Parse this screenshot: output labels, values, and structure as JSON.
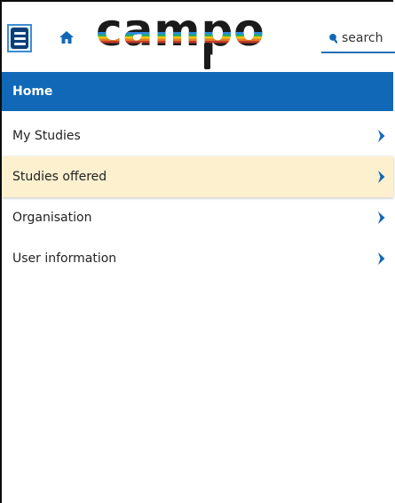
{
  "header": {
    "logo_text": "campo",
    "search": {
      "placeholder": "search"
    },
    "icons": {
      "menu": "hamburger-menu-icon",
      "home": "home-icon",
      "search": "search-icon"
    }
  },
  "home_bar": {
    "label": "Home"
  },
  "menu": {
    "items": [
      {
        "label": "My Studies",
        "active": false
      },
      {
        "label": "Studies offered",
        "active": true
      },
      {
        "label": "Organisation",
        "active": false
      },
      {
        "label": "User information",
        "active": false
      }
    ]
  },
  "colors": {
    "primary": "#1168b6",
    "active_item_bg": "#fdf0cf",
    "menu_button_fill": "#0b3e78",
    "logo_text": "#1a1a1a"
  }
}
